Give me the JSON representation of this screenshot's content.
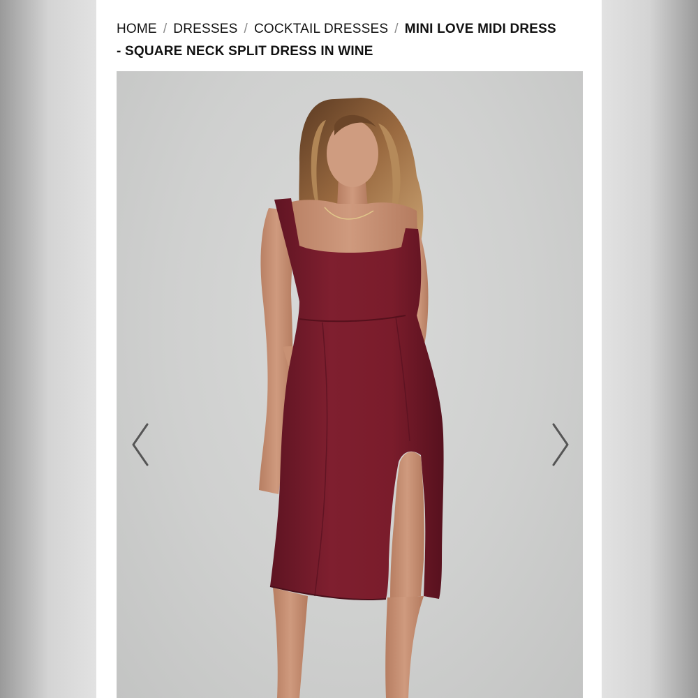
{
  "breadcrumb": {
    "items": [
      "HOME",
      "DRESSES",
      "COCKTAIL DRESSES"
    ],
    "separator": "/",
    "current": "MINI LOVE MIDI DRESS - SQUARE NECK SPLIT DRESS IN WINE"
  },
  "gallery": {
    "prev_icon": "chevron-left-icon",
    "next_icon": "chevron-right-icon"
  },
  "colors": {
    "dress": "#7b1d2c",
    "dress_shadow": "#5a1220",
    "backdrop": "#cfd0cf",
    "skin": "#c58f72",
    "hair": "#8a5a35",
    "text": "#111111"
  }
}
